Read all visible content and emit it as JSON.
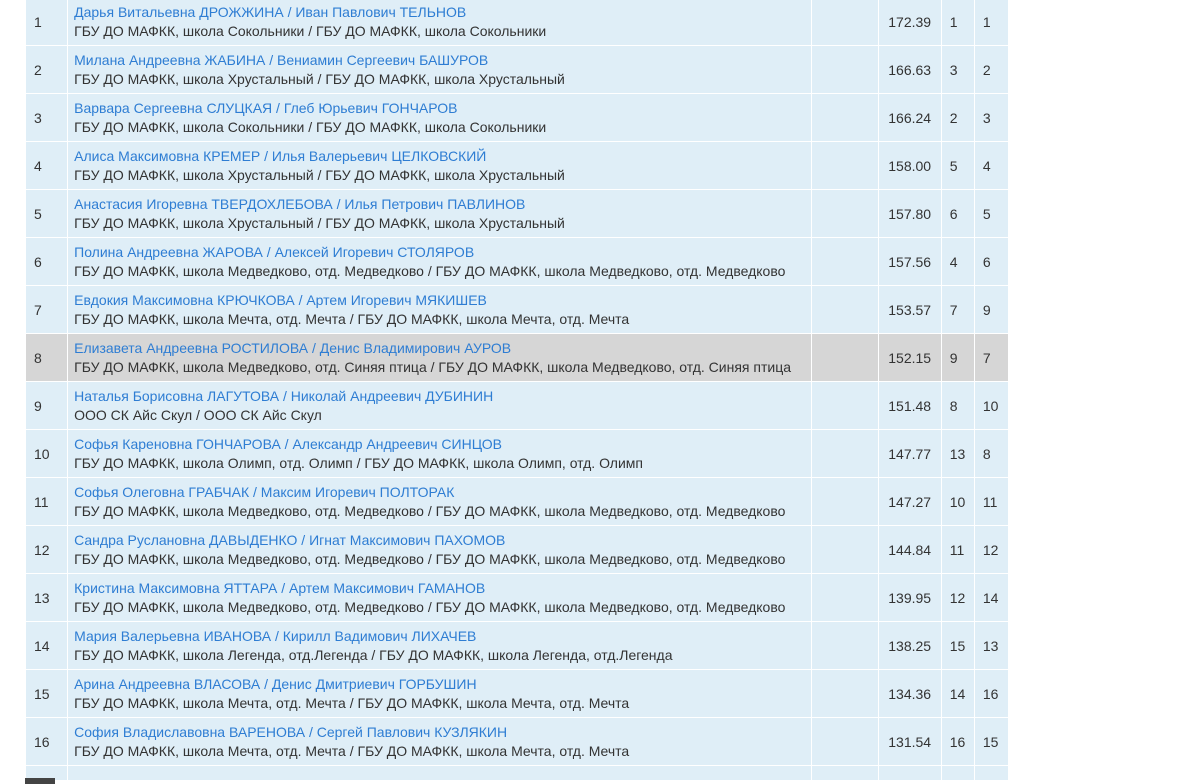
{
  "results": [
    {
      "place": "1",
      "pair": "Дарья Витальевна ДРОЖЖИНА / Иван Павлович ТЕЛЬНОВ",
      "club": "ГБУ ДО МАФКК, школа Сокольники / ГБУ ДО МАФКК, школа Сокольники",
      "score": "172.39",
      "r1": "1",
      "r2": "1"
    },
    {
      "place": "2",
      "pair": "Милана Андреевна ЖАБИНА / Вениамин Сергеевич БАШУРОВ",
      "club": "ГБУ ДО МАФКК, школа Хрустальный / ГБУ ДО МАФКК, школа Хрустальный",
      "score": "166.63",
      "r1": "3",
      "r2": "2"
    },
    {
      "place": "3",
      "pair": "Варвара Сергеевна СЛУЦКАЯ / Глеб Юрьевич ГОНЧАРОВ",
      "club": "ГБУ ДО МАФКК, школа Сокольники / ГБУ ДО МАФКК, школа Сокольники",
      "score": "166.24",
      "r1": "2",
      "r2": "3"
    },
    {
      "place": "4",
      "pair": "Алиса Максимовна КРЕМЕР / Илья Валерьевич ЦЕЛКОВСКИЙ",
      "club": "ГБУ ДО МАФКК, школа Хрустальный / ГБУ ДО МАФКК, школа Хрустальный",
      "score": "158.00",
      "r1": "5",
      "r2": "4"
    },
    {
      "place": "5",
      "pair": "Анастасия Игоревна ТВЕРДОХЛЕБОВА / Илья Петрович ПАВЛИНОВ",
      "club": "ГБУ ДО МАФКК, школа Хрустальный / ГБУ ДО МАФКК, школа Хрустальный",
      "score": "157.80",
      "r1": "6",
      "r2": "5"
    },
    {
      "place": "6",
      "pair": "Полина Андреевна ЖАРОВА / Алексей Игоревич СТОЛЯРОВ",
      "club": "ГБУ ДО МАФКК, школа Медведково, отд. Медведково / ГБУ ДО МАФКК, школа Медведково, отд. Медведково",
      "score": "157.56",
      "r1": "4",
      "r2": "6"
    },
    {
      "place": "7",
      "pair": "Евдокия Максимовна КРЮЧКОВА / Артем Игоревич МЯКИШЕВ",
      "club": "ГБУ ДО МАФКК, школа Мечта, отд. Мечта / ГБУ ДО МАФКК, школа Мечта, отд. Мечта",
      "score": "153.57",
      "r1": "7",
      "r2": "9"
    },
    {
      "place": "8",
      "pair": "Елизавета Андреевна РОСТИЛОВА / Денис Владимирович АУРОВ",
      "club": "ГБУ ДО МАФКК, школа Медведково, отд. Синяя птица / ГБУ ДО МАФКК, школа Медведково, отд. Синяя птица",
      "score": "152.15",
      "r1": "9",
      "r2": "7",
      "highlight": true
    },
    {
      "place": "9",
      "pair": "Наталья Борисовна ЛАГУТОВА / Николай Андреевич ДУБИНИН",
      "club": "ООО СК Айс Скул / ООО СК Айс Скул",
      "score": "151.48",
      "r1": "8",
      "r2": "10"
    },
    {
      "place": "10",
      "pair": "Софья Кареновна ГОНЧАРОВА / Александр Андреевич СИНЦОВ",
      "club": "ГБУ ДО МАФКК, школа Олимп, отд. Олимп / ГБУ ДО МАФКК, школа Олимп, отд. Олимп",
      "score": "147.77",
      "r1": "13",
      "r2": "8"
    },
    {
      "place": "11",
      "pair": "Софья Олеговна ГРАБЧАК / Максим Игоревич ПОЛТОРАК",
      "club": "ГБУ ДО МАФКК, школа Медведково, отд. Медведково / ГБУ ДО МАФКК, школа Медведково, отд. Медведково",
      "score": "147.27",
      "r1": "10",
      "r2": "11"
    },
    {
      "place": "12",
      "pair": "Сандра Руслановна ДАВЫДЕНКО / Игнат Максимович ПАХОМОВ",
      "club": "ГБУ ДО МАФКК, школа Медведково, отд. Медведково / ГБУ ДО МАФКК, школа Медведково, отд. Медведково",
      "score": "144.84",
      "r1": "11",
      "r2": "12"
    },
    {
      "place": "13",
      "pair": "Кристина Максимовна ЯТТАРА / Артем Максимович ГАМАНОВ",
      "club": "ГБУ ДО МАФКК, школа Медведково, отд. Медведково / ГБУ ДО МАФКК, школа Медведково, отд. Медведково",
      "score": "139.95",
      "r1": "12",
      "r2": "14"
    },
    {
      "place": "14",
      "pair": "Мария Валерьевна ИВАНОВА / Кирилл Вадимович ЛИХАЧЕВ",
      "club": "ГБУ ДО МАФКК, школа Легенда, отд.Легенда / ГБУ ДО МАФКК, школа Легенда, отд.Легенда",
      "score": "138.25",
      "r1": "15",
      "r2": "13"
    },
    {
      "place": "15",
      "pair": "Арина Андреевна ВЛАСОВА / Денис Дмитриевич ГОРБУШИН",
      "club": "ГБУ ДО МАФКК, школа Мечта, отд. Мечта / ГБУ ДО МАФКК, школа Мечта, отд. Мечта",
      "score": "134.36",
      "r1": "14",
      "r2": "16"
    },
    {
      "place": "16",
      "pair": "София Владиславовна ВАРЕНОВА / Сергей Павлович КУЗЛЯКИН",
      "club": "ГБУ ДО МАФКК, школа Мечта, отд. Мечта / ГБУ ДО МАФКК, школа Мечта, отд. Мечта",
      "score": "131.54",
      "r1": "16",
      "r2": "15"
    }
  ],
  "colors": {
    "row_bg": "#dfeef7",
    "highlight_bg": "#d6d6d6",
    "link": "#2e7dd3",
    "text": "#333333"
  }
}
